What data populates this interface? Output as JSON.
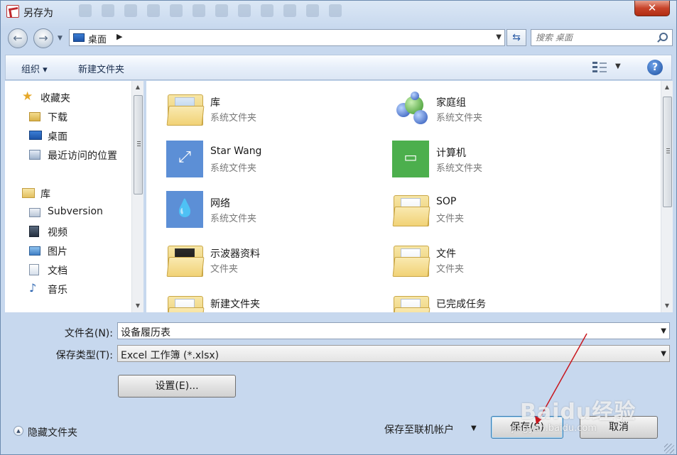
{
  "window": {
    "title": "另存为",
    "close_label": "✕"
  },
  "nav": {
    "back_symbol": "←",
    "forward_symbol": "→",
    "address": "桌面",
    "search_placeholder": "搜索 桌面"
  },
  "toolbar": {
    "organize": "组织 ▾",
    "new_folder": "新建文件夹"
  },
  "sidebar": {
    "favorites": "收藏夹",
    "downloads": "下载",
    "desktop": "桌面",
    "recent": "最近访问的位置",
    "libraries": "库",
    "subversion": "Subversion",
    "videos": "视频",
    "pictures": "图片",
    "documents": "文档",
    "music": "音乐"
  },
  "items": [
    {
      "name": "库",
      "type": "系统文件夹"
    },
    {
      "name": "家庭组",
      "type": "系统文件夹"
    },
    {
      "name": "Star Wang",
      "type": "系统文件夹"
    },
    {
      "name": "计算机",
      "type": "系统文件夹"
    },
    {
      "name": "网络",
      "type": "系统文件夹"
    },
    {
      "name": "SOP",
      "type": "文件夹"
    },
    {
      "name": "示波器资料",
      "type": "文件夹"
    },
    {
      "name": "文件",
      "type": "文件夹"
    },
    {
      "name": "新建文件夹",
      "type": ""
    },
    {
      "name": "已完成任务",
      "type": ""
    }
  ],
  "form": {
    "filename_label": "文件名(N):",
    "filename_value": "设备履历表",
    "filetype_label": "保存类型(T):",
    "filetype_value": "Excel 工作簿 (*.xlsx)",
    "settings_button": "设置(E)..."
  },
  "footer": {
    "hide_folders": "隐藏文件夹",
    "save_online": "保存至联机帐户",
    "save_button": "保存(S)",
    "cancel_button": "取消"
  },
  "watermark": {
    "brand": "Baidu经验",
    "url": "jingyan.baidu.com"
  },
  "colors": {
    "accent": "#1d54a8",
    "annotation_arrow": "#c8171e",
    "close": "#c7432a"
  }
}
